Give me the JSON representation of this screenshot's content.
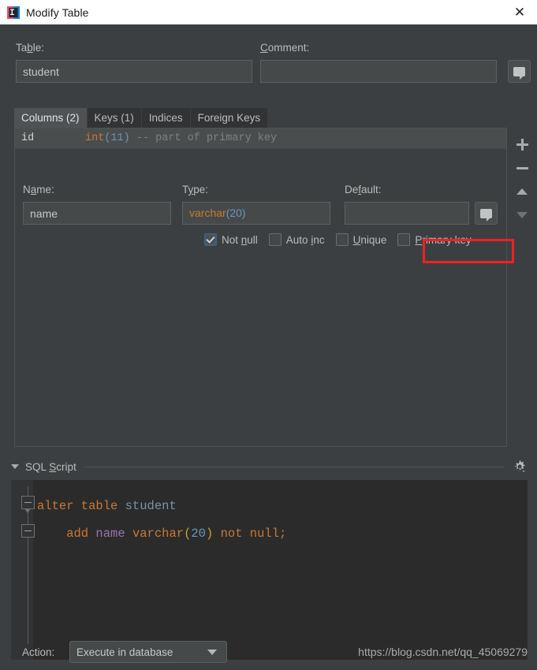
{
  "window": {
    "title": "Modify Table",
    "app_icon": "intellij-idea-icon",
    "close_label": "✕"
  },
  "form": {
    "table_label": "Table:",
    "table_label_mnemonic": "b",
    "table_value": "student",
    "comment_label": "Comment:",
    "comment_label_mnemonic": "C",
    "comment_value": "",
    "comment_button_icon": "comment-bubble-icon"
  },
  "tabs": [
    {
      "label": "Columns (2)",
      "selected": true
    },
    {
      "label": "Keys (1)",
      "selected": false
    },
    {
      "label": "Indices",
      "selected": false
    },
    {
      "label": "Foreign Keys",
      "selected": false
    }
  ],
  "columns_list": [
    {
      "name": "id",
      "type": "int",
      "length": "(11)",
      "comment": "-- part of primary key"
    }
  ],
  "column_editor": {
    "name_label": "Name:",
    "name_value": "name",
    "type_label": "Type:",
    "type_value": "varchar",
    "type_length": "(20)",
    "default_label": "Default:",
    "default_value": "",
    "default_button_icon": "comment-bubble-icon",
    "checkboxes": [
      {
        "label": "Not null",
        "checked": true,
        "highlighted": false
      },
      {
        "label": "Auto inc",
        "checked": false,
        "highlighted": false
      },
      {
        "label": "Unique",
        "checked": false,
        "highlighted": false
      },
      {
        "label": "Primary key",
        "checked": false,
        "highlighted": true
      }
    ],
    "highlight_color": "#f02020"
  },
  "side_toolbar": [
    {
      "icon": "plus-icon",
      "enabled": true
    },
    {
      "icon": "minus-icon",
      "enabled": true
    },
    {
      "icon": "arrow-up-icon",
      "enabled": true
    },
    {
      "icon": "arrow-down-icon",
      "enabled": false
    }
  ],
  "sql_section": {
    "title": "SQL Script",
    "expanded": true,
    "settings_icon": "gear-icon",
    "collapse_icon": "triangle-down-icon",
    "code_lines": [
      {
        "tokens": [
          {
            "text": "alter table ",
            "style": "keyword"
          },
          {
            "text": "student",
            "style": "identifier"
          }
        ]
      },
      {
        "tokens": [
          {
            "text": "    add ",
            "style": "keyword"
          },
          {
            "text": "name ",
            "style": "column"
          },
          {
            "text": "varchar",
            "style": "keyword"
          },
          {
            "text": "(",
            "style": "paren"
          },
          {
            "text": "20",
            "style": "number"
          },
          {
            "text": ")",
            "style": "paren"
          },
          {
            "text": " not null;",
            "style": "keyword"
          }
        ]
      }
    ]
  },
  "bottom_bar": {
    "action_label": "Action:",
    "action_value": "Execute in database",
    "watermark": "https://blog.csdn.net/qq_45069279"
  }
}
